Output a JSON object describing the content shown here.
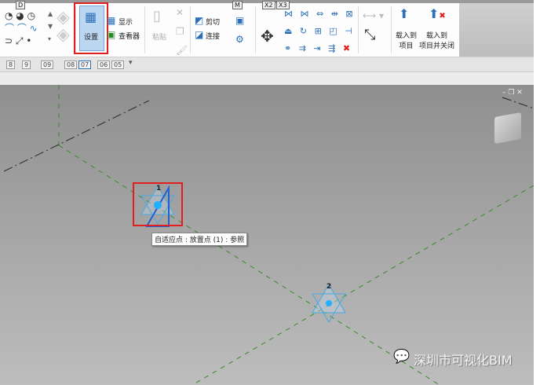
{
  "keytips": [
    "D",
    "M",
    "X2",
    "X3"
  ],
  "ribbon": {
    "settings_label": "设置",
    "show_label": "显示",
    "viewer_label": "查看器",
    "paste_label": "粘贴",
    "cut_label": "剪切",
    "join_label": "连接",
    "load_to_project_label": "载入到\n项目",
    "load_to_project_close_label": "载入到\n项目并关闭"
  },
  "tabs": [
    "8",
    "9",
    "09",
    "08",
    "07",
    "06",
    "05"
  ],
  "tooltip": "自适应点 : 放置点 (1) : 参照",
  "points": [
    "1",
    "2"
  ],
  "watermark": "深圳市可视化BIM",
  "colors": {
    "highlight": "#e02020",
    "grid": "#3a8a2a",
    "point": "#1fb0ff"
  }
}
